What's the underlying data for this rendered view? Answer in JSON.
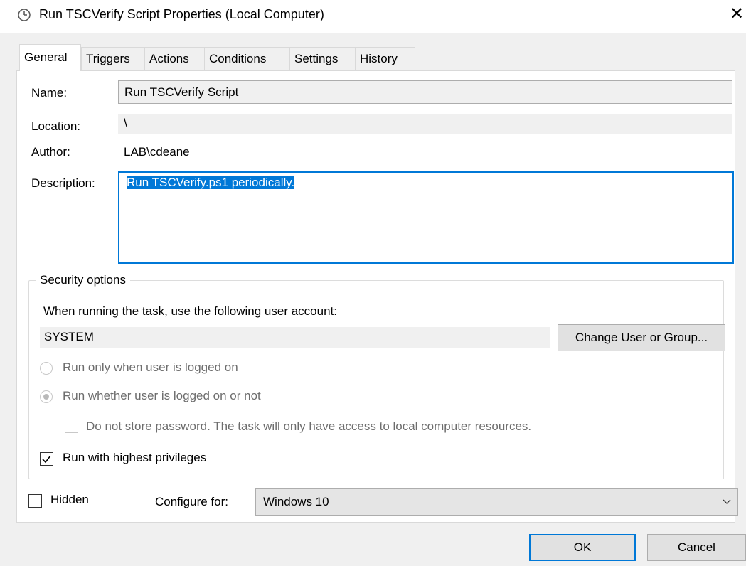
{
  "window": {
    "title": "Run TSCVerify Script Properties (Local Computer)",
    "close_glyph": "✕",
    "title_icon": "clock-icon"
  },
  "tabs": [
    {
      "label": "General",
      "active": true
    },
    {
      "label": "Triggers",
      "active": false
    },
    {
      "label": "Actions",
      "active": false
    },
    {
      "label": "Conditions",
      "active": false
    },
    {
      "label": "Settings",
      "active": false
    },
    {
      "label": "History",
      "active": false
    }
  ],
  "general": {
    "name_label": "Name:",
    "name_value": "Run TSCVerify Script",
    "location_label": "Location:",
    "location_value": "\\",
    "author_label": "Author:",
    "author_value": "LAB\\cdeane",
    "description_label": "Description:",
    "description_value": "Run TSCVerify.ps1 periodically."
  },
  "security": {
    "group_title": "Security options",
    "account_prompt": "When running the task, use the following user account:",
    "account_value": "SYSTEM",
    "change_button": "Change User or Group...",
    "radio_logged_on": "Run only when user is logged on",
    "radio_whether": "Run whether user is logged on or not",
    "no_store_password": "Do not store password.  The task will only have access to local computer resources.",
    "highest_privileges": "Run with highest privileges",
    "highest_privileges_checked": true
  },
  "bottom": {
    "hidden_label": "Hidden",
    "hidden_checked": false,
    "configure_label": "Configure for:",
    "configure_value": "Windows 10"
  },
  "buttons": {
    "ok": "OK",
    "cancel": "Cancel"
  },
  "colors": {
    "accent": "#0078d7",
    "dialog_bg": "#f0f0f0"
  }
}
